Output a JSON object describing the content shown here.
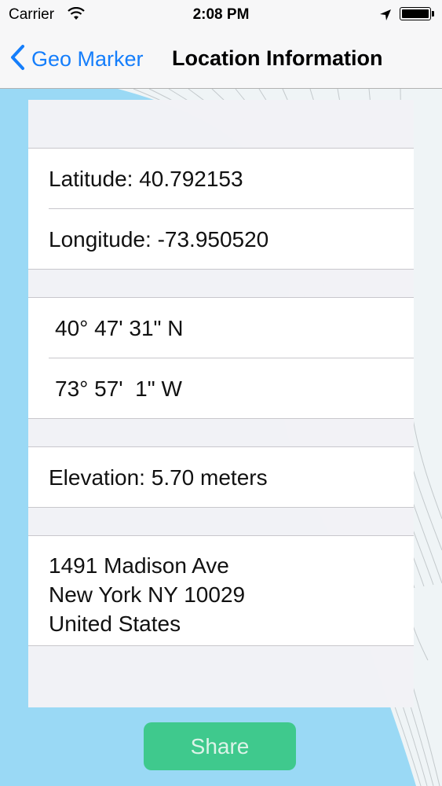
{
  "status_bar": {
    "carrier": "Carrier",
    "time": "2:08 PM",
    "wifi_icon": "wifi-icon",
    "location_icon": "location-arrow-icon",
    "battery_icon": "battery-icon"
  },
  "nav": {
    "back_label": "Geo Marker",
    "back_icon": "chevron-left-icon",
    "title": "Location Information"
  },
  "location": {
    "latitude": "Latitude: 40.792153",
    "longitude": "Longitude: -73.950520",
    "lat_dms": "40° 47' 31\" N",
    "lon_dms": "73° 57'  1\" W",
    "elevation": "Elevation: 5.70 meters",
    "address": {
      "street": "1491 Madison Ave",
      "city_line": "New York NY 10029",
      "country": "United States"
    }
  },
  "share_button": {
    "label": "Share"
  },
  "colors": {
    "accent": "#157efb",
    "share_button": "#3fc98d",
    "background": "#9ad9f5"
  }
}
